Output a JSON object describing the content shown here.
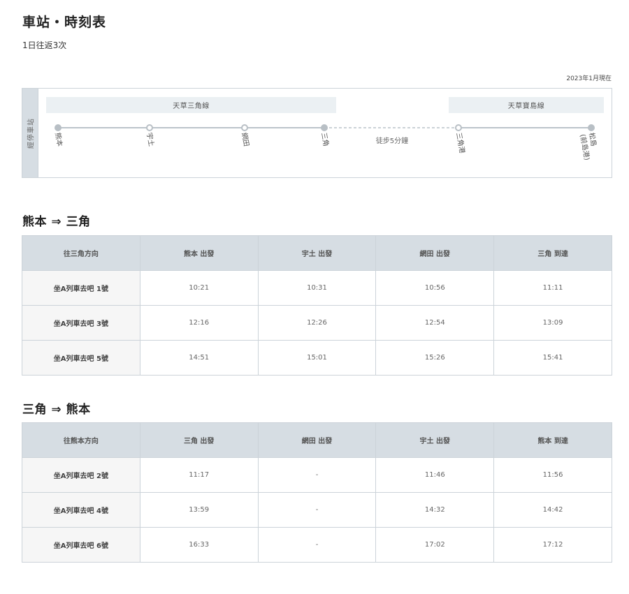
{
  "header": {
    "title": "車站・時刻表",
    "subtitle": "1日往返3次",
    "as_of": "2023年1月現在"
  },
  "route": {
    "side_label": "經停車站",
    "lines": [
      "天草三角線",
      "天草寶島線"
    ],
    "walk_label": "徒步5分鐘",
    "stations": [
      "熊本",
      "宇土",
      "網田",
      "三角",
      "三角港",
      "松島\n(前島港)"
    ]
  },
  "outbound": {
    "title": "熊本 ⇒ 三角",
    "headers": [
      "往三角方向",
      "熊本 出發",
      "宇土 出發",
      "網田 出發",
      "三角 到達"
    ],
    "rows": [
      [
        "坐A列車去吧 1號",
        "10:21",
        "10:31",
        "10:56",
        "11:11"
      ],
      [
        "坐A列車去吧 3號",
        "12:16",
        "12:26",
        "12:54",
        "13:09"
      ],
      [
        "坐A列車去吧 5號",
        "14:51",
        "15:01",
        "15:26",
        "15:41"
      ]
    ]
  },
  "inbound": {
    "title": "三角 ⇒ 熊本",
    "headers": [
      "往熊本方向",
      "三角 出發",
      "網田 出發",
      "宇土 出發",
      "熊本 到達"
    ],
    "rows": [
      [
        "坐A列車去吧 2號",
        "11:17",
        "-",
        "11:46",
        "11:56"
      ],
      [
        "坐A列車去吧 4號",
        "13:59",
        "-",
        "14:32",
        "14:42"
      ],
      [
        "坐A列車去吧 6號",
        "16:33",
        "-",
        "17:02",
        "17:12"
      ]
    ]
  }
}
